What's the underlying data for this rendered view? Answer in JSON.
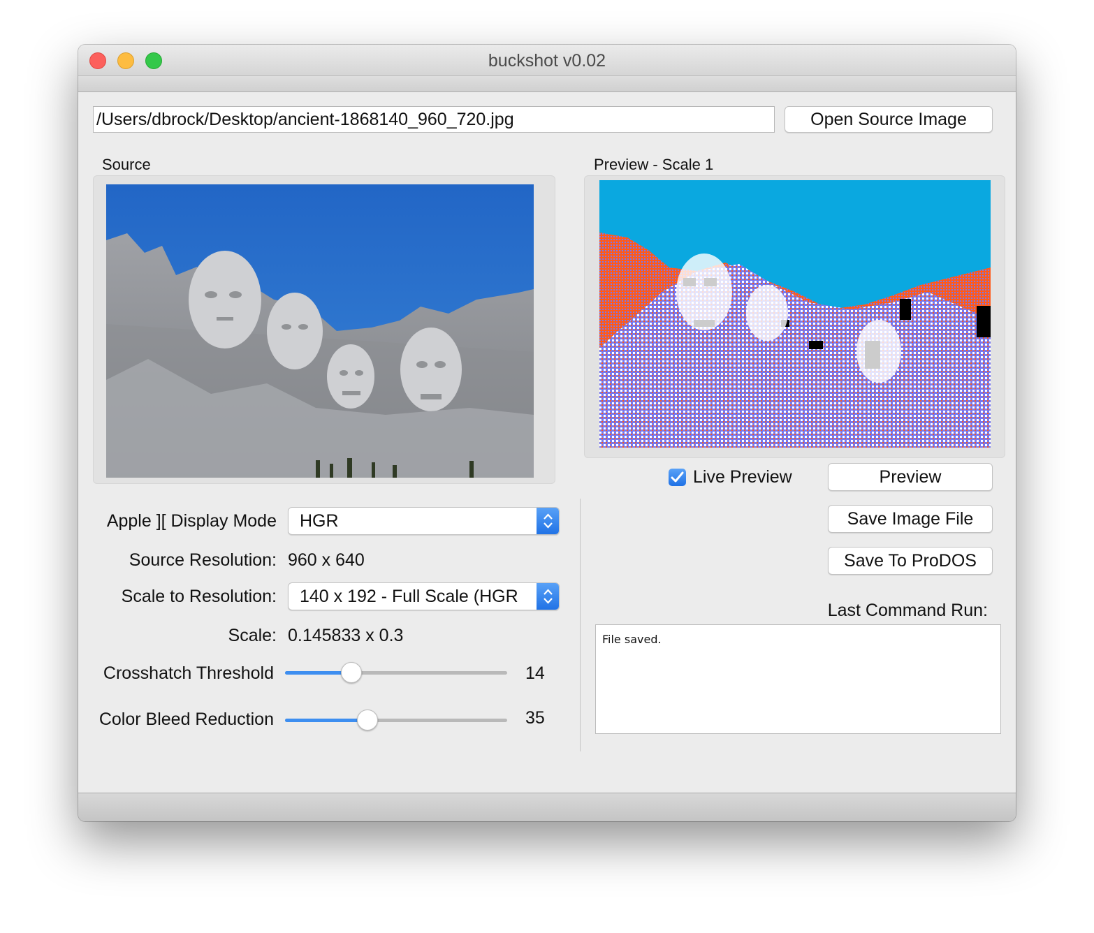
{
  "window": {
    "title": "buckshot  v0.02"
  },
  "source_path": {
    "value": "/Users/dbrock/Desktop/ancient-1868140_960_720.jpg",
    "open_button_label": "Open Source Image"
  },
  "source_panel": {
    "label": "Source",
    "image_description": "mount-rushmore-photo"
  },
  "preview_panel": {
    "label": "Preview - Scale 1",
    "image_description": "apple-ii-hgr-dithered-preview"
  },
  "controls": {
    "display_mode_label": "Apple ][ Display Mode",
    "display_mode_value": "HGR",
    "source_resolution_label": "Source Resolution:",
    "source_resolution_value": "960 x 640",
    "scale_to_label": "Scale to Resolution:",
    "scale_to_value": "140 x 192 - Full Scale (HGR",
    "scale_label": "Scale:",
    "scale_value": "0.145833 x 0.3",
    "crosshatch_label": "Crosshatch Threshold",
    "crosshatch_value": "14",
    "crosshatch_fraction": 0.3,
    "color_bleed_label": "Color Bleed Reduction",
    "color_bleed_value": "35",
    "color_bleed_fraction": 0.37
  },
  "actions": {
    "live_preview_label": "Live Preview",
    "live_preview_checked": true,
    "preview_button": "Preview",
    "save_image_button": "Save Image File",
    "save_prodos_button": "Save To ProDOS",
    "last_command_label": "Last Command Run:",
    "last_command_output": "File saved."
  },
  "colors": {
    "accent": "#3d8ef0",
    "hgr_sky": "#0aa8e0",
    "hgr_orange": "#ff5a1a",
    "hgr_violet": "#7878ee"
  }
}
